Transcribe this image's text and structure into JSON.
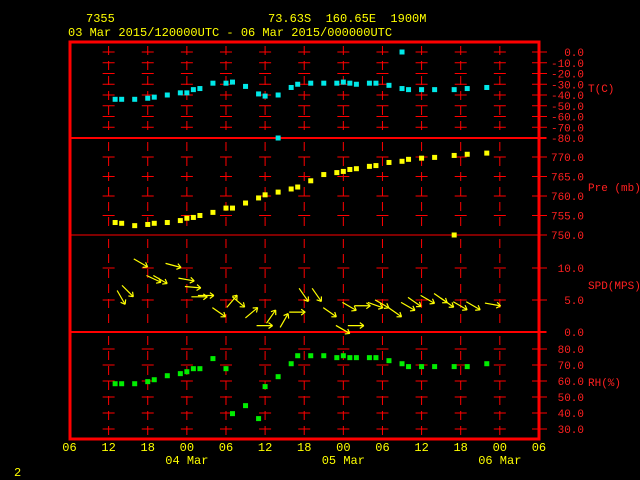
{
  "header": {
    "station": "7355",
    "location": "73.63S  160.65E  1900M",
    "period": "03 Mar 2015/120000UTC - 06 Mar 2015/000000UTC"
  },
  "footer": {
    "page_number": "2"
  },
  "colors": {
    "frame": "#ff0000",
    "text": "#ffff00",
    "temperature": "#00e8e8",
    "pressure": "#ffff00",
    "wind": "#ffff00",
    "humidity": "#00ee00"
  },
  "chart_data": {
    "type": "scatter",
    "title": "7355  73.63S 160.65E 1900M",
    "subtitle": "03 Mar 2015/120000UTC - 06 Mar 2015/000000UTC",
    "x_axis": {
      "unit": "hours since 03 Mar 06UTC",
      "range": [
        0,
        72
      ],
      "tick_labels": [
        "06",
        "12",
        "18",
        "00",
        "06",
        "12",
        "18",
        "00",
        "06",
        "12",
        "18",
        "00",
        "06"
      ],
      "date_labels": [
        {
          "label": "04 Mar",
          "hour": 18
        },
        {
          "label": "05 Mar",
          "hour": 42
        },
        {
          "label": "06 Mar",
          "hour": 66
        }
      ]
    },
    "panels": [
      {
        "name": "temperature",
        "label": "T(C)",
        "range": [
          -80,
          0
        ],
        "tick_labels": [
          "0.0",
          "-10.0",
          "-20.0",
          "-30.0",
          "-40.0",
          "-50.0",
          "-60.0",
          "-70.0",
          "-80.0"
        ],
        "ticks": [
          0,
          -10,
          -20,
          -30,
          -40,
          -50,
          -60,
          -70,
          -80
        ],
        "hours": [
          7,
          8,
          10,
          12,
          13,
          15,
          17,
          18,
          19,
          20,
          22,
          24,
          25,
          27,
          29,
          30,
          32,
          34,
          35,
          37,
          39,
          41,
          42,
          43,
          44,
          46,
          47,
          49,
          51,
          52,
          54,
          56,
          59,
          61,
          64,
          51,
          32
        ],
        "values": [
          -44,
          -44,
          -44,
          -43,
          -42,
          -40,
          -38,
          -38,
          -35,
          -34,
          -29,
          -29,
          -28,
          -32,
          -39,
          -41,
          -40,
          -33,
          -30,
          -29,
          -29,
          -29,
          -28,
          -29,
          -30,
          -29,
          -29,
          -31,
          -34,
          -35,
          -35,
          -35,
          -35,
          -34,
          -33,
          0,
          -80
        ]
      },
      {
        "name": "pressure",
        "label": "Pre (mb)",
        "range": [
          750,
          774
        ],
        "tick_labels": [
          "770.0",
          "765.0",
          "760.0",
          "755.0",
          "750.0"
        ],
        "ticks": [
          770,
          765,
          760,
          755,
          750
        ],
        "hours": [
          7,
          8,
          10,
          12,
          13,
          15,
          17,
          18,
          19,
          20,
          22,
          24,
          25,
          27,
          29,
          30,
          32,
          34,
          35,
          37,
          39,
          41,
          42,
          43,
          44,
          46,
          47,
          49,
          51,
          52,
          54,
          56,
          59,
          61,
          64,
          59
        ],
        "values": [
          753.2,
          753.0,
          752.4,
          752.7,
          753.0,
          753.2,
          753.7,
          754.3,
          754.5,
          755.0,
          755.8,
          756.9,
          756.9,
          758.2,
          759.5,
          760.3,
          761.0,
          761.8,
          762.3,
          763.9,
          765.5,
          766.0,
          766.3,
          766.8,
          767.0,
          767.6,
          767.8,
          768.6,
          768.9,
          769.4,
          769.7,
          769.9,
          770.4,
          770.7,
          771.0,
          750.0
        ]
      },
      {
        "name": "wind",
        "label": "SPD(MPS)",
        "range": [
          0,
          12
        ],
        "tick_labels": [
          "10.0",
          "5.0",
          "0.0"
        ],
        "ticks": [
          10,
          5,
          0
        ],
        "hours": [
          7,
          8,
          10,
          12,
          13,
          15,
          17,
          18,
          19,
          20,
          22,
          24,
          25,
          27,
          29,
          30,
          32,
          34,
          35,
          37,
          39,
          41,
          42,
          43,
          44,
          46,
          47,
          49,
          51,
          52,
          54,
          56,
          57,
          59,
          61,
          64
        ],
        "values": [
          5.4,
          6.4,
          10.8,
          8.3,
          8.2,
          10.4,
          8.2,
          7.0,
          5.5,
          5.7,
          3.1,
          4.8,
          4.7,
          3.0,
          1.0,
          2.4,
          1.8,
          3.1,
          5.8,
          5.8,
          3.1,
          0.4,
          4.0,
          1.0,
          4.1,
          4.2,
          4.4,
          3.1,
          4.0,
          4.7,
          5.1,
          5.3,
          4.6,
          4.1,
          4.1,
          4.3
        ],
        "arrow_bearing_deg_cw_from_east": [
          60,
          45,
          30,
          25,
          30,
          15,
          10,
          5,
          0,
          0,
          35,
          -50,
          40,
          -40,
          0,
          -55,
          -60,
          0,
          55,
          55,
          35,
          30,
          30,
          0,
          0,
          20,
          30,
          35,
          30,
          35,
          30,
          35,
          35,
          30,
          30,
          10
        ]
      },
      {
        "name": "humidity",
        "label": "RH(%)",
        "range": [
          30,
          85
        ],
        "tick_labels": [
          "80.0",
          "70.0",
          "60.0",
          "50.0",
          "40.0",
          "30.0"
        ],
        "ticks": [
          80,
          70,
          60,
          50,
          40,
          30
        ],
        "hours": [
          7,
          8,
          10,
          12,
          13,
          15,
          17,
          18,
          19,
          20,
          22,
          24,
          25,
          27,
          29,
          30,
          32,
          34,
          35,
          37,
          39,
          41,
          42,
          43,
          44,
          46,
          47,
          49,
          51,
          52,
          54,
          56,
          59,
          61,
          64
        ],
        "values": [
          58.3,
          58.3,
          58.3,
          59.6,
          60.8,
          63.3,
          64.6,
          65.8,
          67.7,
          67.7,
          74.0,
          67.7,
          39.6,
          44.6,
          36.5,
          56.5,
          62.7,
          70.8,
          75.8,
          75.8,
          75.8,
          74.6,
          75.8,
          74.6,
          74.6,
          74.6,
          74.6,
          72.7,
          70.8,
          69.0,
          69.0,
          69.0,
          69.0,
          69.0,
          70.8
        ]
      }
    ],
    "grid": true
  }
}
